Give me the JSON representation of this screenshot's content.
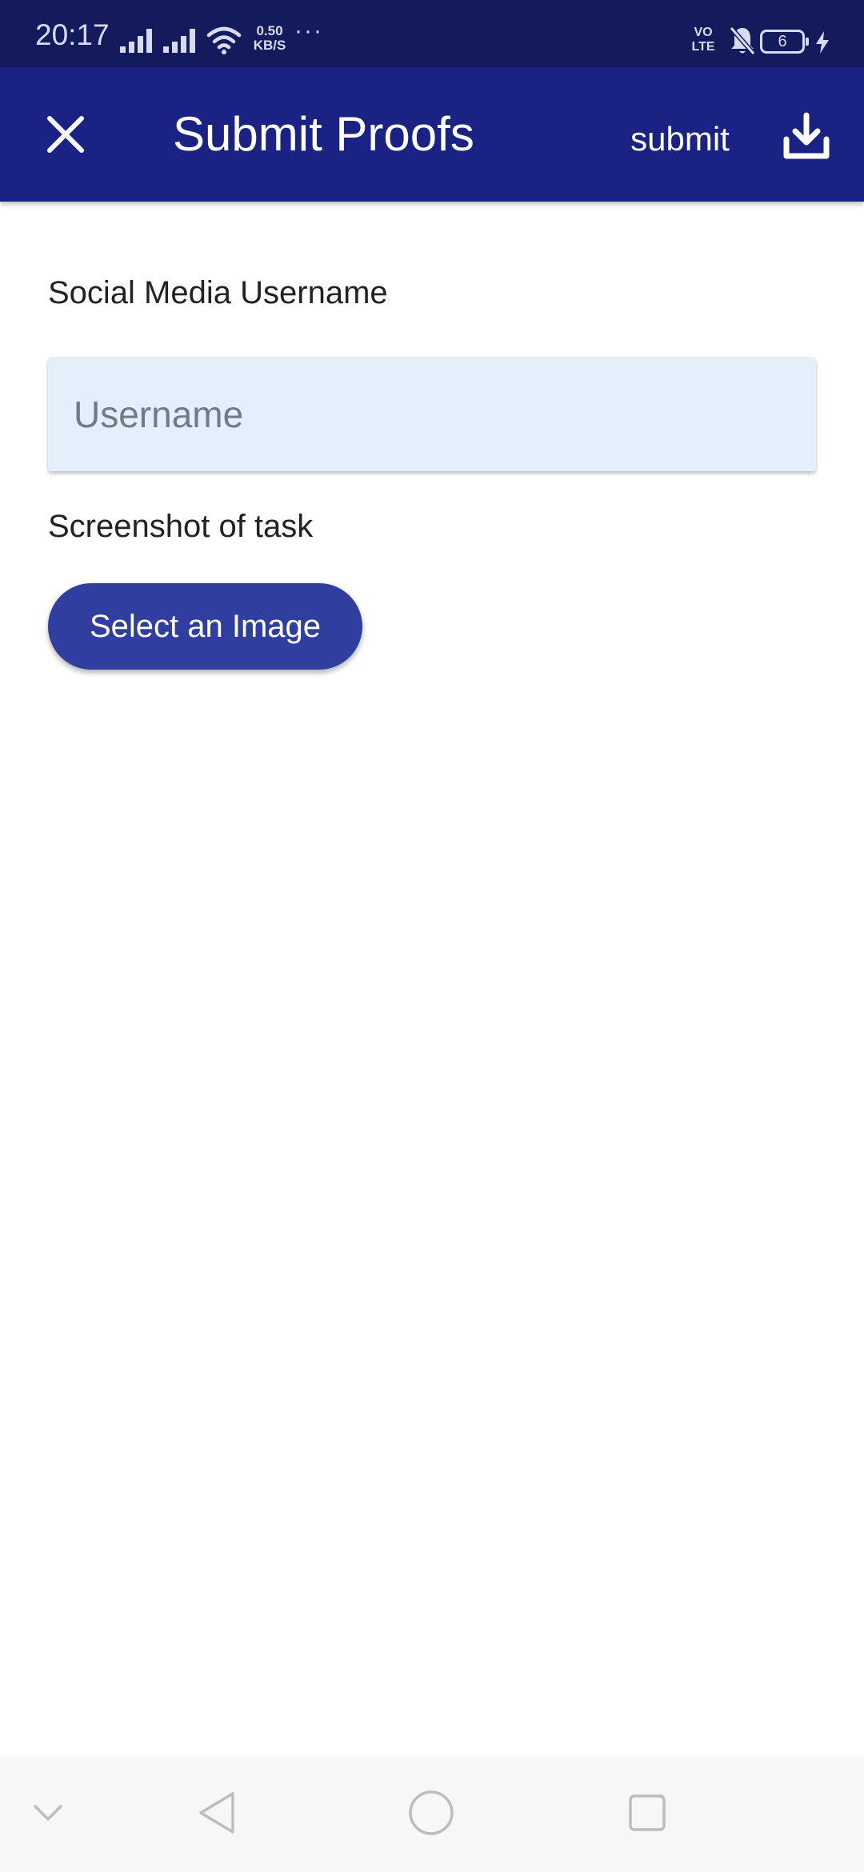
{
  "status_bar": {
    "time": "20:17",
    "network_speed_value": "0.50",
    "network_speed_unit": "KB/S",
    "more": "···",
    "volte_top": "VO",
    "volte_bottom": "LTE",
    "battery_level": "6",
    "icons": [
      "signal-icon",
      "signal-icon",
      "wifi-icon",
      "mute-icon",
      "battery-icon",
      "charging-icon"
    ]
  },
  "app_bar": {
    "title": "Submit Proofs",
    "submit_label": "submit",
    "close_icon": "close-icon",
    "download_icon": "download-icon",
    "background_color": "#1a2383"
  },
  "form": {
    "username_label": "Social Media Username",
    "username_placeholder": "Username",
    "username_value": "",
    "screenshot_label": "Screenshot of task",
    "select_image_label": "Select an Image",
    "button_color": "#303f9f",
    "field_color": "#e3f0fb"
  },
  "nav_bar": {
    "icons": [
      "chevron-down-icon",
      "back-icon",
      "home-icon",
      "recent-apps-icon"
    ]
  }
}
